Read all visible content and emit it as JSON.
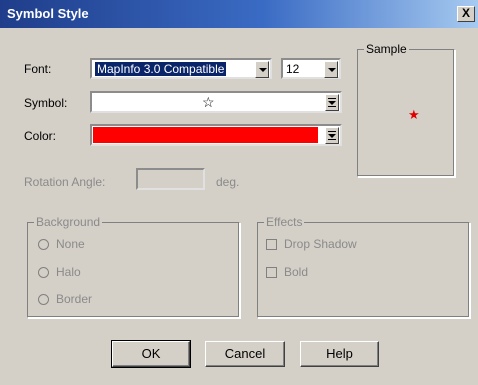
{
  "window": {
    "title": "Symbol Style",
    "close_label": "X"
  },
  "form": {
    "font_label": "Font:",
    "font_value": "MapInfo 3.0 Compatible",
    "size_value": "12",
    "symbol_label": "Symbol:",
    "symbol_glyph": "☆",
    "color_label": "Color:",
    "color_value": "#ff0000",
    "rotation_label": "Rotation Angle:",
    "rotation_value": "",
    "rotation_unit": "deg."
  },
  "sample": {
    "title": "Sample",
    "glyph": "★",
    "glyph_color": "#e00000"
  },
  "background": {
    "title": "Background",
    "options": [
      "None",
      "Halo",
      "Border"
    ]
  },
  "effects": {
    "title": "Effects",
    "options": [
      "Drop Shadow",
      "Bold"
    ]
  },
  "buttons": {
    "ok": "OK",
    "cancel": "Cancel",
    "help": "Help"
  }
}
